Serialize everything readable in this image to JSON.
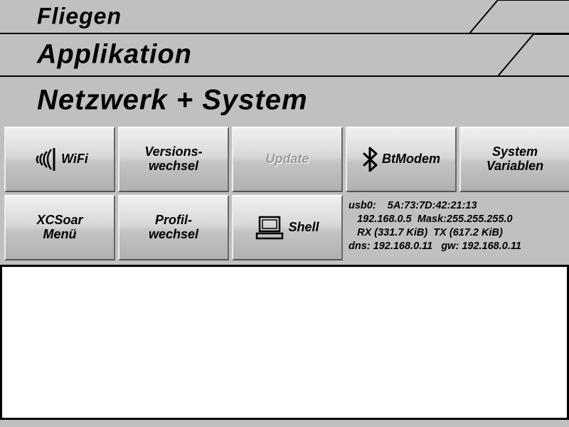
{
  "tabs": {
    "t1": "Fliegen",
    "t2": "Applikation",
    "t3": "Netzwerk + System"
  },
  "buttons": {
    "wifi": "WiFi",
    "version_l1": "Versions-",
    "version_l2": "wechsel",
    "update": "Update",
    "btmodem": "BtModem",
    "sysvar_l1": "System",
    "sysvar_l2": "Variablen",
    "xcsoar_l1": "XCSoar",
    "xcsoar_l2": "Menü",
    "profil_l1": "Profil-",
    "profil_l2": "wechsel",
    "shell": "Shell"
  },
  "net": {
    "iface": "usb0:",
    "mac": "5A:73:7D:42:21:13",
    "ip": "192.168.0.5",
    "mask_label": "Mask:",
    "mask": "255.255.255.0",
    "rx_label": "RX",
    "rx": "(331.7 KiB)",
    "tx_label": "TX",
    "tx": "(617.2 KiB)",
    "dns_label": "dns:",
    "dns": "192.168.0.11",
    "gw_label": "gw:",
    "gw": "192.168.0.11"
  }
}
